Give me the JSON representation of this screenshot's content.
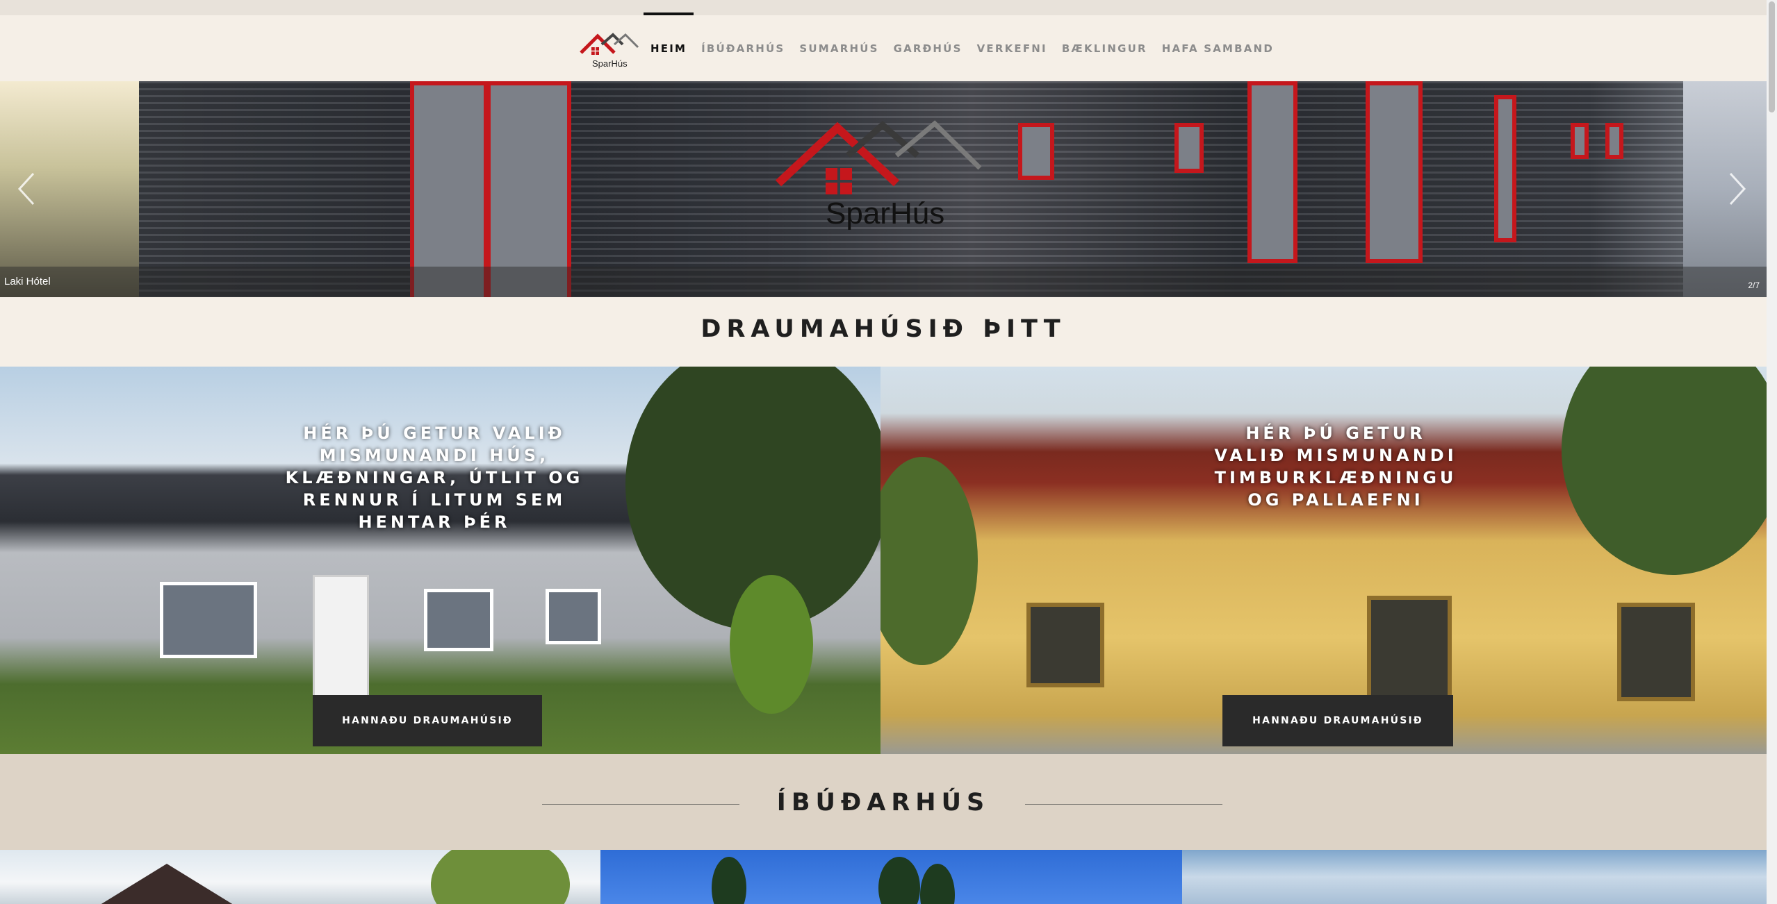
{
  "brand": {
    "logo_text": "SparHús",
    "red": "#c5171c",
    "dark": "#2a2a2a"
  },
  "nav": {
    "items": [
      {
        "label": "HEIM",
        "active": true
      },
      {
        "label": "ÍBÚÐARHÚS"
      },
      {
        "label": "SUMARHÚS"
      },
      {
        "label": "GARÐHÚS"
      },
      {
        "label": "VERKEFNI"
      },
      {
        "label": "BÆKLINGUR"
      },
      {
        "label": "HAFA SAMBAND"
      }
    ]
  },
  "slideshow": {
    "caption": "Laki Hótel",
    "counter": "2/7",
    "prev_icon": "chevron-left-icon",
    "next_icon": "chevron-right-icon"
  },
  "section1": {
    "title": "DRAUMAHÚSIÐ ÞITT"
  },
  "panels": [
    {
      "text": "HÉR ÞÚ GETUR VALIÐ MISMUNANDI HÚS, KLÆÐNINGAR, ÚTLIT OG RENNUR Í LITUM SEM HENTAR ÞÉR",
      "button": "HANNAÐU DRAUMAHÚSIÐ"
    },
    {
      "text": "HÉR ÞÚ GETUR VALIÐ  MISMUNANDI TIMBURKLÆÐNINGU OG PALLAEFNI",
      "button": "HANNAÐU DRAUMAHÚSIÐ"
    }
  ],
  "section2": {
    "title": "ÍBÚÐARHÚS"
  }
}
